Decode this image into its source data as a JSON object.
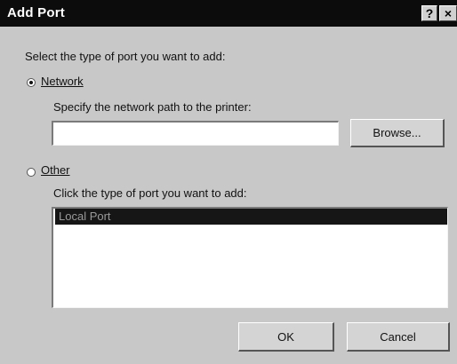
{
  "window": {
    "title": "Add Port",
    "help_glyph": "?",
    "close_glyph": "×"
  },
  "main": {
    "prompt": "Select the type of port you want to add:",
    "network": {
      "label": "Network",
      "selected": true,
      "hint": "Specify the network path to the printer:",
      "path_value": "",
      "browse_label": "Browse..."
    },
    "other": {
      "label": "Other",
      "selected": false,
      "hint": "Click the type of port you want to add:",
      "port_types": [
        "Local Port"
      ],
      "selected_port": "Local Port"
    }
  },
  "buttons": {
    "ok_label": "OK",
    "cancel_label": "Cancel"
  }
}
